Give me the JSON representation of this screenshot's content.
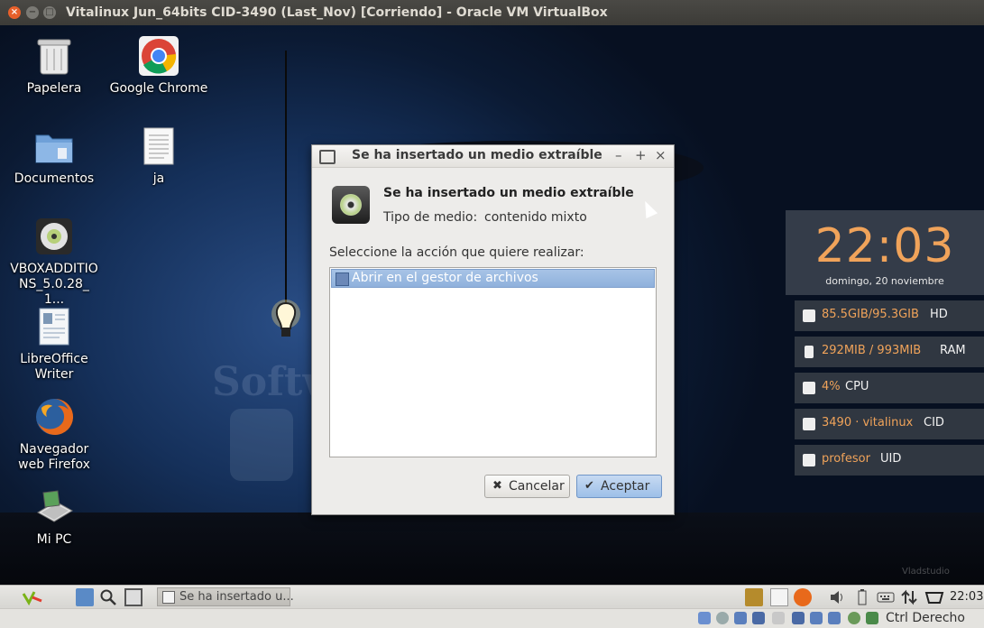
{
  "host_window": {
    "title": "Vitalinux Jun_64bits CID-3490 (Last_Nov) [Corriendo] - Oracle VM VirtualBox",
    "close_glyph": "×",
    "minimize_glyph": "−",
    "maximize_glyph": "□"
  },
  "desktop": {
    "icons": [
      {
        "label": "Papelera",
        "icon": "trash-icon"
      },
      {
        "label": "Google Chrome",
        "icon": "chrome-icon"
      },
      {
        "label": "Documentos",
        "icon": "folder-icon"
      },
      {
        "label": "ja",
        "icon": "text-file-icon"
      },
      {
        "label": "VBOXADDITIONS_5.0.28_1...",
        "icon": "cd-icon"
      },
      {
        "label": "LibreOffice Writer",
        "icon": "writer-icon"
      },
      {
        "label": "Navegador web Firefox",
        "icon": "firefox-icon"
      },
      {
        "label": "Mi PC",
        "icon": "computer-icon"
      }
    ],
    "watermark": "Softw",
    "wallpaper_credit": "Vladstudio"
  },
  "dialog": {
    "title": "Se ha insertado un medio extraíble",
    "controls": {
      "minimize": "–",
      "maximize": "+",
      "close": "×"
    },
    "heading": "Se ha insertado un medio extraíble",
    "media_type_label": "Tipo de medio:",
    "media_type_value": "contenido mixto",
    "prompt": "Seleccione la acción que quiere realizar:",
    "actions": [
      {
        "label": "Abrir en el gestor de archivos",
        "selected": true
      }
    ],
    "cancel_label": "Cancelar",
    "cancel_glyph": "✖",
    "accept_label": "Aceptar",
    "accept_glyph": "✔"
  },
  "conky": {
    "time": "22:03",
    "date": "domingo, 20 noviembre",
    "rows": [
      {
        "value": "85.5GIB/95.3GIB",
        "unit": "HD",
        "icon": "disk-icon"
      },
      {
        "value": "292MIB / 993MIB",
        "unit": "RAM",
        "icon": "ram-icon"
      },
      {
        "value": "4%",
        "unit": "CPU",
        "icon": "cpu-icon"
      },
      {
        "value": "3490 · vitalinux",
        "unit": "CID",
        "icon": "id-card-icon"
      },
      {
        "value": "profesor",
        "unit": "UID",
        "icon": "user-icon"
      }
    ],
    "accent": "#f0a35a"
  },
  "taskbar": {
    "window_button_label": "Se ha insertado u...",
    "clock": "22:03"
  },
  "host_status": {
    "host_key": "Ctrl Derecho"
  }
}
